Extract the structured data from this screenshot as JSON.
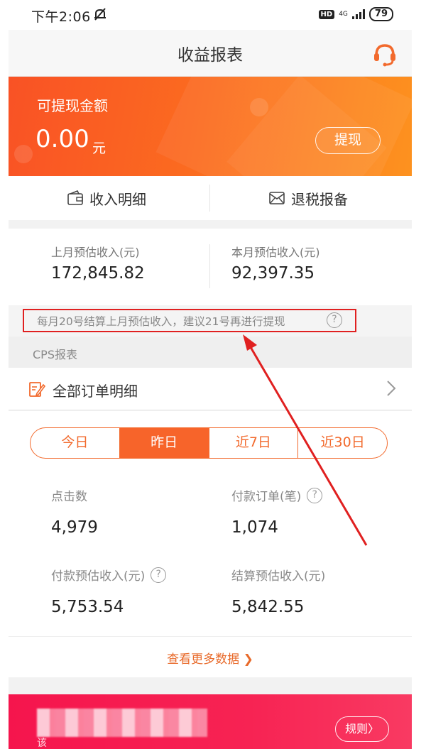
{
  "status_bar": {
    "time": "下午2:06",
    "hd": "HD",
    "network": "4G",
    "battery": "79"
  },
  "header": {
    "title": "收益报表"
  },
  "balance": {
    "label": "可提现金额",
    "amount": "0.00",
    "unit": "元",
    "withdraw_label": "提现"
  },
  "quick_links": {
    "income_detail": "收入明细",
    "tax_filing": "退税报备"
  },
  "estimates": {
    "last_month_label": "上月预估收入(元)",
    "last_month_value": "172,845.82",
    "this_month_label": "本月预估收入(元)",
    "this_month_value": "92,397.35"
  },
  "notice": {
    "text": "每月20号结算上月预估收入，建议21号再进行提现",
    "help": "?"
  },
  "section": {
    "title": "CPS报表"
  },
  "orders": {
    "label": "全部订单明细"
  },
  "tabs": [
    {
      "label": "今日"
    },
    {
      "label": "昨日"
    },
    {
      "label": "近7日"
    },
    {
      "label": "近30日"
    }
  ],
  "stats": {
    "clicks_label": "点击数",
    "clicks_value": "4,979",
    "paid_orders_label": "付款订单(笔)",
    "paid_orders_value": "1,074",
    "paid_income_label": "付款预估收入(元)",
    "paid_income_value": "5,753.54",
    "settled_income_label": "结算预估收入(元)",
    "settled_income_value": "5,842.55"
  },
  "more": {
    "label": "查看更多数据 ❯"
  },
  "banner": {
    "small_text": "该",
    "rules_label": "规则〉"
  },
  "colors": {
    "accent": "#f7642a",
    "annotation": "#e02020"
  }
}
